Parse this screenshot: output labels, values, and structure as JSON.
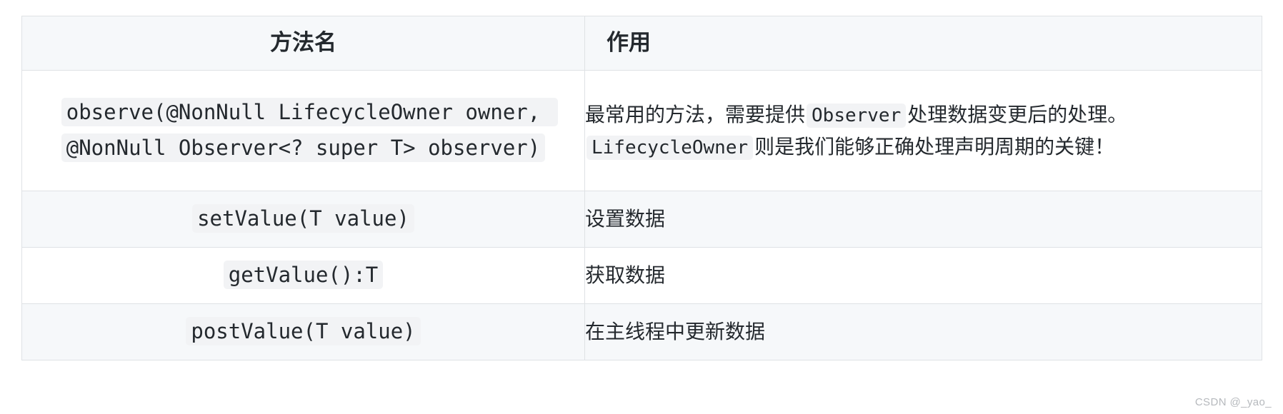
{
  "table": {
    "headers": {
      "method": "方法名",
      "effect": "作用"
    },
    "rows": [
      {
        "method_code_lines": [
          "observe(@NonNull LifecycleOwner owner, @NonNull Observer<? super T> observer)"
        ],
        "method_code": "observe(@NonNull LifecycleOwner owner, @NonNull Observer<? super T> observer)",
        "desc_parts": [
          {
            "type": "text",
            "value": "最常用的方法，需要提供"
          },
          {
            "type": "code",
            "value": "Observer"
          },
          {
            "type": "text",
            "value": "处理数据变更后的处理。"
          },
          {
            "type": "code",
            "value": "LifecycleOwner"
          },
          {
            "type": "text",
            "value": "则是我们能够正确处理声明周期的关键！"
          }
        ],
        "desc_text_1": "最常用的方法，需要提供",
        "desc_code_1": "Observer",
        "desc_text_2": "处理数据变更后的处理。",
        "desc_code_2": "LifecycleOwner",
        "desc_text_3": "则是我们能够正确处理声明周期的关键！"
      },
      {
        "method_code": "setValue(T value)",
        "desc_text": "设置数据"
      },
      {
        "method_code": "getValue():T",
        "desc_text": "获取数据"
      },
      {
        "method_code": "postValue(T value)",
        "desc_text": "在主线程中更新数据"
      }
    ]
  },
  "watermark": "CSDN @_yao_",
  "colors": {
    "border": "#dfe2e5",
    "header_bg": "#f6f8fa",
    "stripe_bg": "#f6f8fa",
    "code_bg": "#f2f3f5",
    "text": "#24292e",
    "watermark": "#b6b9bd"
  }
}
